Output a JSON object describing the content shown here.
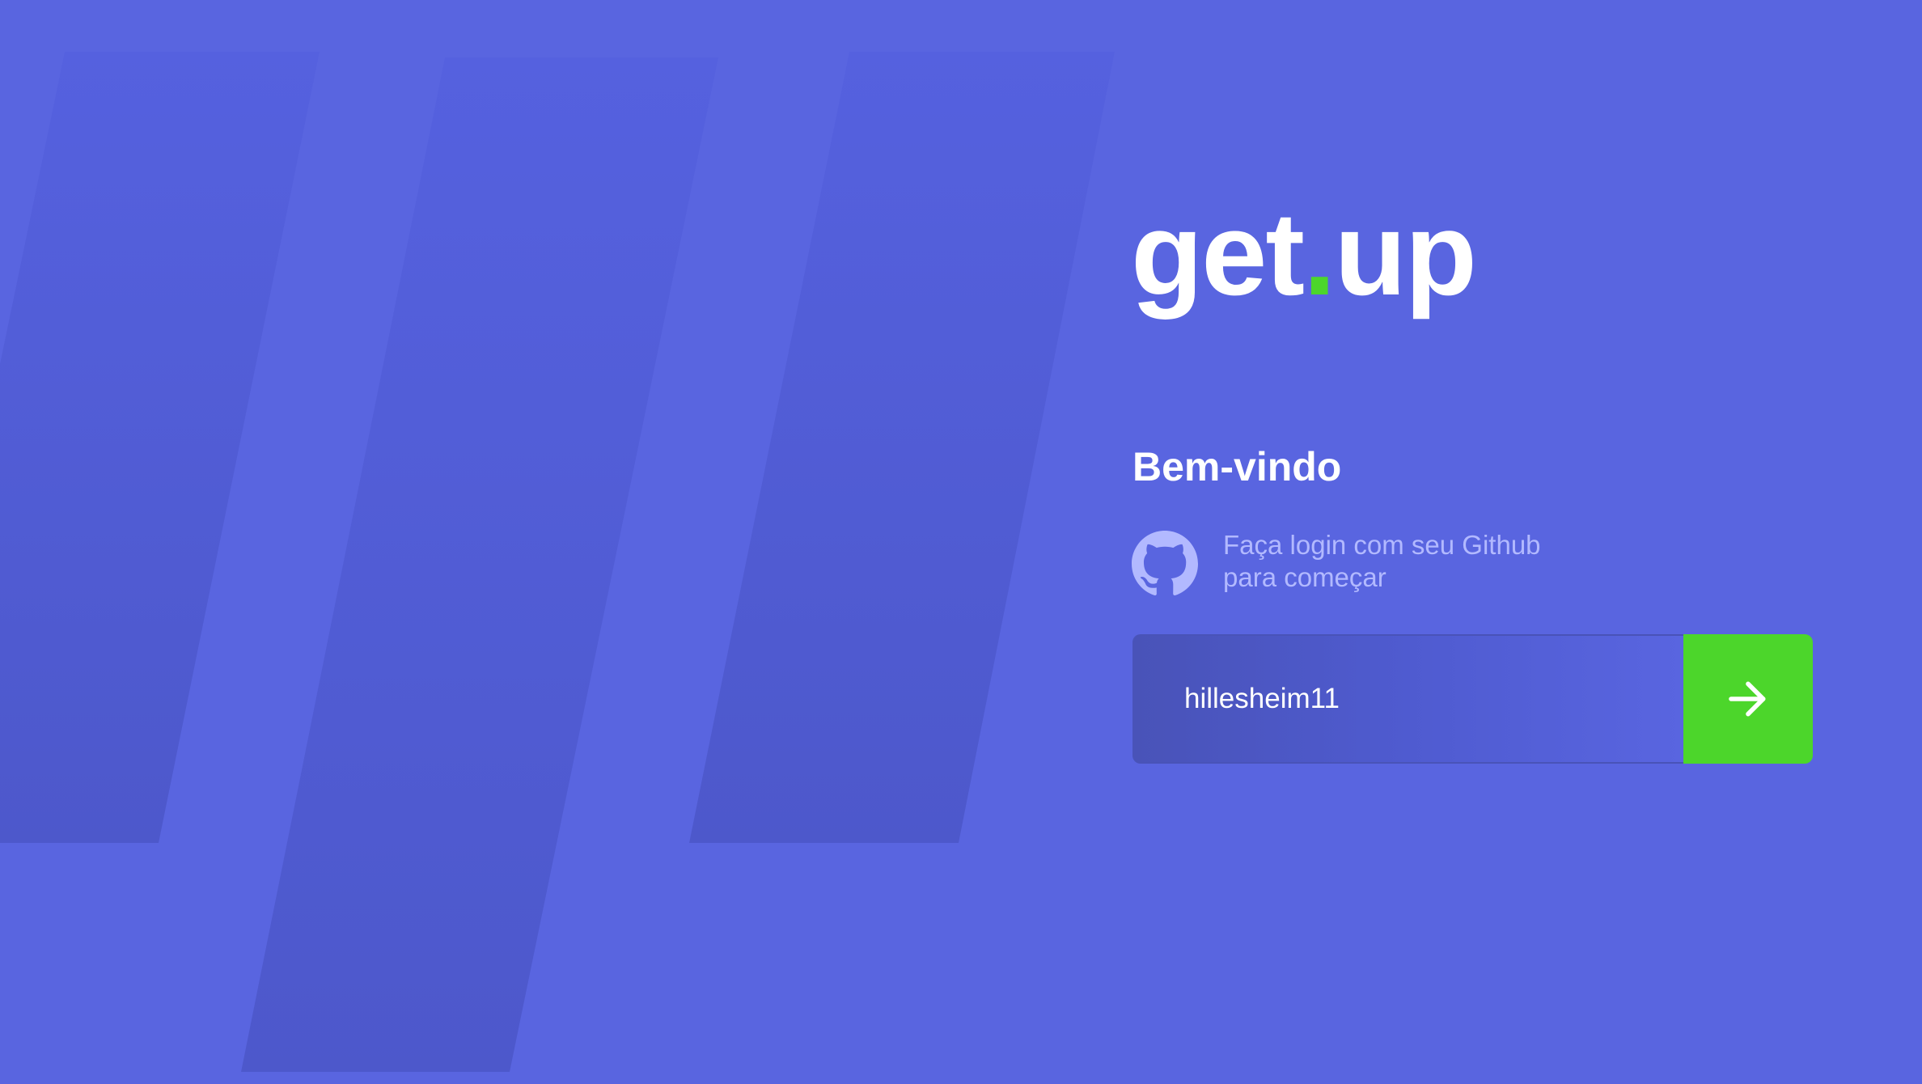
{
  "brand": {
    "name_part1": "get",
    "name_dot": ".",
    "name_part2": "up",
    "dot_color": "#4CD62B"
  },
  "login": {
    "heading": "Bem-vindo",
    "github_icon": "github-icon",
    "hint_line1": "Faça login com seu Github",
    "hint_line2": "para começar",
    "username_value": "hillesheim11",
    "submit_icon": "arrow-right-icon"
  },
  "colors": {
    "background": "#5965E0",
    "accent_green": "#4CD62B",
    "text_primary": "#FFFFFF",
    "text_muted": "#B2B9FF",
    "input_dark": "#4953B8"
  }
}
